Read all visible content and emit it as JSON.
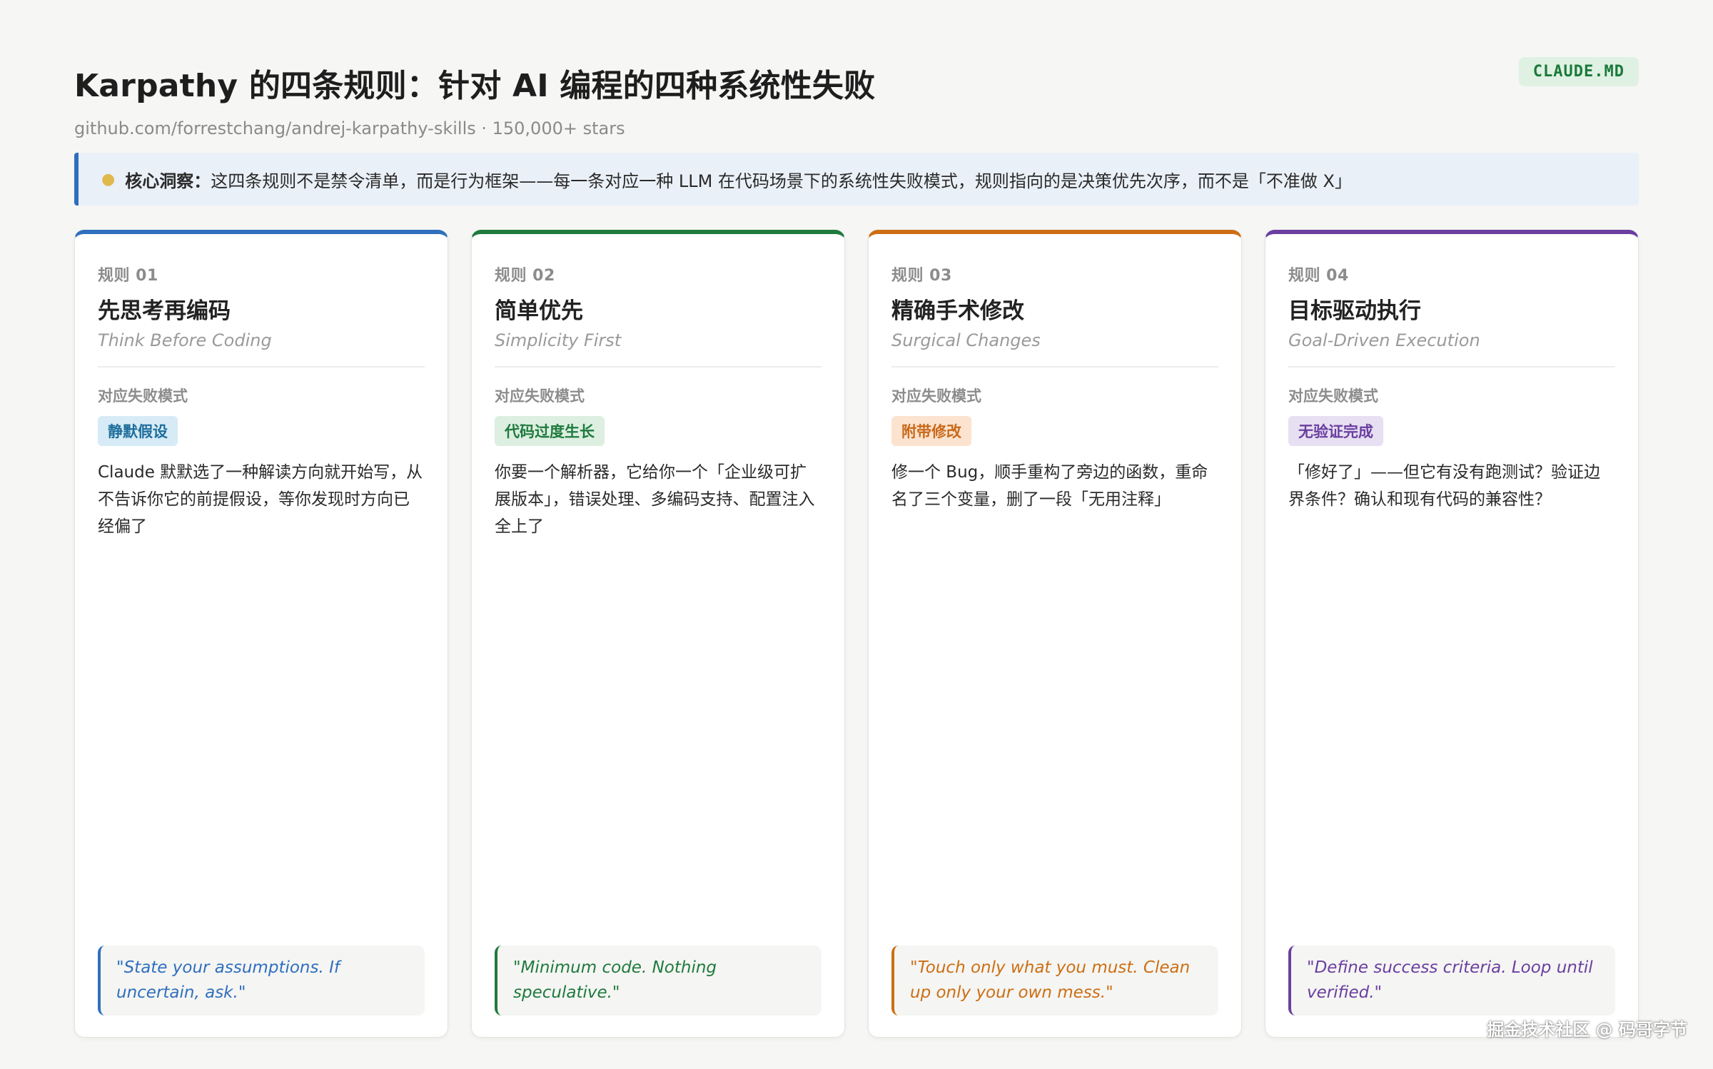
{
  "header": {
    "title": "Karpathy 的四条规则：针对 AI 编程的四种系统性失败",
    "subtitle": "github.com/forrestchang/andrej-karpathy-skills · 150,000+ stars",
    "badge": "CLAUDE.MD"
  },
  "insight": {
    "icon": "lightbulb-icon",
    "label": "核心洞察：",
    "text": "这四条规则不是禁令清单，而是行为框架——每一条对应一种 LLM 在代码场景下的系统性失败模式，规则指向的是决策优先次序，而不是「不准做 X」"
  },
  "fail_label": "对应失败模式",
  "cards": [
    {
      "number": "规则 01",
      "title_cn": "先思考再编码",
      "title_en": "Think Before Coding",
      "failure_tag": "静默假设",
      "description": "Claude 默默选了一种解读方向就开始写，从不告诉你它的前提假设，等你发现时方向已经偏了",
      "quote": "\"State your assumptions. If uncertain, ask.\"",
      "accent": "#2f6fbd",
      "tag_bg": "#d6ebf6",
      "tag_fg": "#1f6e9c"
    },
    {
      "number": "规则 02",
      "title_cn": "简单优先",
      "title_en": "Simplicity First",
      "failure_tag": "代码过度生长",
      "description": "你要一个解析器，它给你一个「企业级可扩展版本」，错误处理、多编码支持、配置注入全上了",
      "quote": "\"Minimum code. Nothing speculative.\"",
      "accent": "#1f7a3e",
      "tag_bg": "#dcefe0",
      "tag_fg": "#1f7a3e"
    },
    {
      "number": "规则 03",
      "title_cn": "精确手术修改",
      "title_en": "Surgical Changes",
      "failure_tag": "附带修改",
      "description": "修一个 Bug，顺手重构了旁边的函数，重命名了三个变量，删了一段「无用注释」",
      "quote": "\"Touch only what you must. Clean up only your own mess.\"",
      "accent": "#cc6f14",
      "tag_bg": "#fbe3cf",
      "tag_fg": "#c8691a"
    },
    {
      "number": "规则 04",
      "title_cn": "目标驱动执行",
      "title_en": "Goal-Driven Execution",
      "failure_tag": "无验证完成",
      "description": "「修好了」——但它有没有跑测试？验证边界条件？确认和现有代码的兼容性？",
      "quote": "\"Define success criteria. Loop until verified.\"",
      "accent": "#6a3fa0",
      "tag_bg": "#e7dff2",
      "tag_fg": "#6a3fa0"
    }
  ],
  "watermark": "掘金技术社区 @ 码哥字节"
}
